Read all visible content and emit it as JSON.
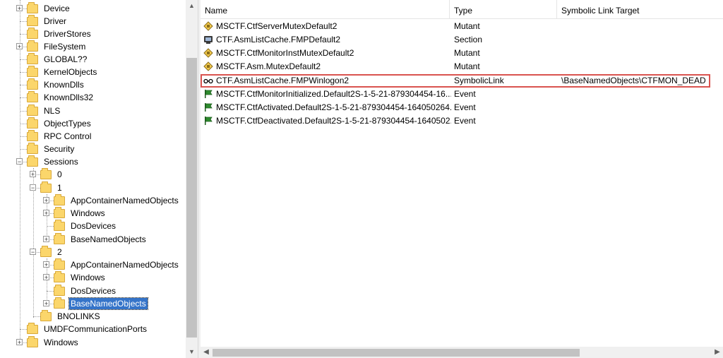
{
  "tree": {
    "items": [
      {
        "label": "Device"
      },
      {
        "label": "Driver"
      },
      {
        "label": "DriverStores"
      },
      {
        "label": "FileSystem"
      },
      {
        "label": "GLOBAL??"
      },
      {
        "label": "KernelObjects"
      },
      {
        "label": "KnownDlls"
      },
      {
        "label": "KnownDlls32"
      },
      {
        "label": "NLS"
      },
      {
        "label": "ObjectTypes"
      },
      {
        "label": "RPC Control"
      },
      {
        "label": "Security"
      },
      {
        "label": "Sessions"
      },
      {
        "label": "0"
      },
      {
        "label": "1"
      },
      {
        "label": "AppContainerNamedObjects"
      },
      {
        "label": "Windows"
      },
      {
        "label": "DosDevices"
      },
      {
        "label": "BaseNamedObjects"
      },
      {
        "label": "2"
      },
      {
        "label": "AppContainerNamedObjects"
      },
      {
        "label": "Windows"
      },
      {
        "label": "DosDevices"
      },
      {
        "label": "BaseNamedObjects"
      },
      {
        "label": "BNOLINKS"
      },
      {
        "label": "UMDFCommunicationPorts"
      },
      {
        "label": "Windows"
      }
    ],
    "selected_index": 23
  },
  "list": {
    "columns": [
      "Name",
      "Type",
      "Symbolic Link Target"
    ],
    "rows": [
      {
        "icon": "mutex-icon",
        "name": "MSCTF.CtfServerMutexDefault2",
        "type": "Mutant",
        "target": ""
      },
      {
        "icon": "section-icon",
        "name": "CTF.AsmListCache.FMPDefault2",
        "type": "Section",
        "target": ""
      },
      {
        "icon": "mutex-icon",
        "name": "MSCTF.CtfMonitorInstMutexDefault2",
        "type": "Mutant",
        "target": ""
      },
      {
        "icon": "mutex-icon",
        "name": "MSCTF.Asm.MutexDefault2",
        "type": "Mutant",
        "target": ""
      },
      {
        "icon": "symlink-icon",
        "name": "CTF.AsmListCache.FMPWinlogon2",
        "type": "SymbolicLink",
        "target": "\\BaseNamedObjects\\CTFMON_DEAD"
      },
      {
        "icon": "event-flag-icon",
        "name": "MSCTF.CtfMonitorInitialized.Default2S-1-5-21-879304454-16...",
        "type": "Event",
        "target": ""
      },
      {
        "icon": "event-flag-icon",
        "name": "MSCTF.CtfActivated.Default2S-1-5-21-879304454-164050264...",
        "type": "Event",
        "target": ""
      },
      {
        "icon": "event-flag-icon",
        "name": "MSCTF.CtfDeactivated.Default2S-1-5-21-879304454-1640502...",
        "type": "Event",
        "target": ""
      }
    ]
  },
  "colors": {
    "folder": "#fbd66b",
    "selection": "#3574c9",
    "highlight_border": "#d9534f",
    "event_flag": "#2e8b2e"
  }
}
